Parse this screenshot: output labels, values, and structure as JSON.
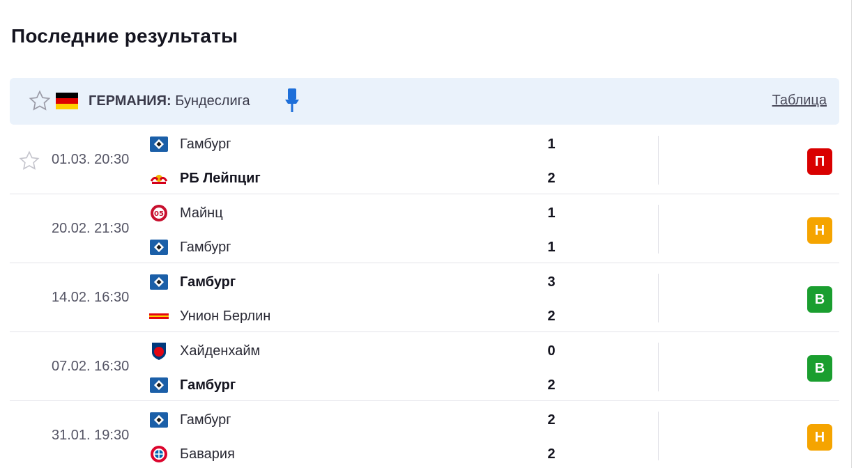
{
  "section": {
    "title": "Последние результаты"
  },
  "league": {
    "country": "ГЕРМАНИЯ:",
    "name": "Бундеслига",
    "table_link": "Таблица",
    "flag_colors": [
      "#000000",
      "#dd0000",
      "#ffce00"
    ]
  },
  "result_colors": {
    "П": "#d90000",
    "Н": "#f5a400",
    "В": "#1a9e2f"
  },
  "matches": [
    {
      "time": "01.03. 20:30",
      "home": {
        "name": "Гамбург",
        "logo": "hsv-icon",
        "bold": false,
        "score": "1"
      },
      "away": {
        "name": "РБ Лейпциг",
        "logo": "rb-leipzig-icon",
        "bold": true,
        "score": "2"
      },
      "result": "П"
    },
    {
      "time": "20.02. 21:30",
      "home": {
        "name": "Майнц",
        "logo": "mainz-icon",
        "bold": false,
        "score": "1"
      },
      "away": {
        "name": "Гамбург",
        "logo": "hsv-icon",
        "bold": false,
        "score": "1"
      },
      "result": "Н"
    },
    {
      "time": "14.02. 16:30",
      "home": {
        "name": "Гамбург",
        "logo": "hsv-icon",
        "bold": true,
        "score": "3"
      },
      "away": {
        "name": "Унион Берлин",
        "logo": "union-berlin-icon",
        "bold": false,
        "score": "2"
      },
      "result": "В"
    },
    {
      "time": "07.02. 16:30",
      "home": {
        "name": "Хайденхайм",
        "logo": "heidenheim-icon",
        "bold": false,
        "score": "0"
      },
      "away": {
        "name": "Гамбург",
        "logo": "hsv-icon",
        "bold": true,
        "score": "2"
      },
      "result": "В"
    },
    {
      "time": "31.01. 19:30",
      "home": {
        "name": "Гамбург",
        "logo": "hsv-icon",
        "bold": false,
        "score": "2"
      },
      "away": {
        "name": "Бавария",
        "logo": "bayern-icon",
        "bold": false,
        "score": "2"
      },
      "result": "Н"
    }
  ]
}
